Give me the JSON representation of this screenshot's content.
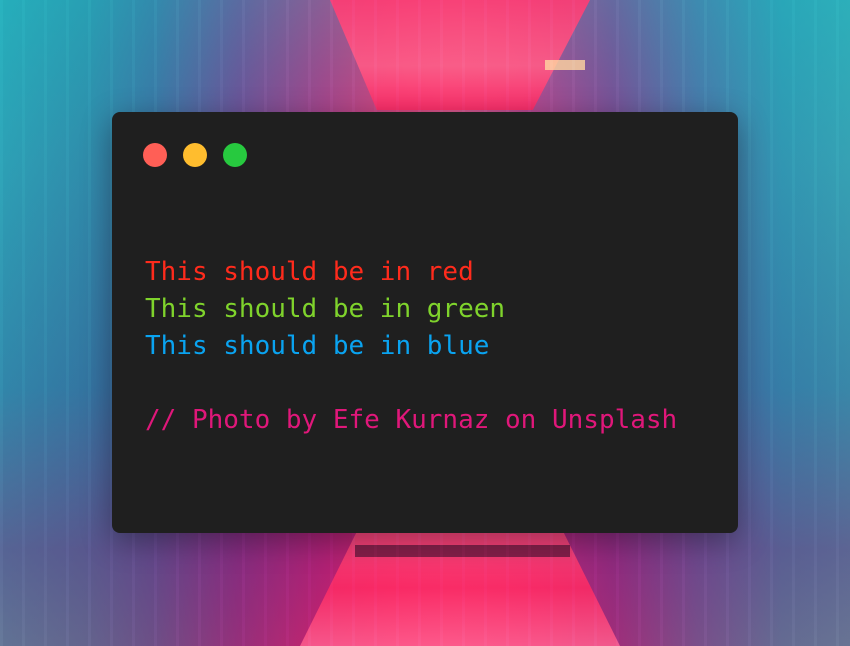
{
  "window": {
    "controls": [
      {
        "name": "close",
        "color": "#ff5f56"
      },
      {
        "name": "minimize",
        "color": "#ffbd2e"
      },
      {
        "name": "maximize",
        "color": "#27c93f"
      }
    ],
    "background_color": "#1f1f1f"
  },
  "code": {
    "lines": [
      {
        "text": "This should be in red",
        "color": "#ff2b1c"
      },
      {
        "text": "This should be in green",
        "color": "#7fd32c"
      },
      {
        "text": "This should be in blue",
        "color": "#0aa3f0"
      }
    ],
    "comment": {
      "text": "// Photo by Efe Kurnaz on Unsplash",
      "color": "#e0177a"
    }
  },
  "colors": {
    "red": "#ff2b1c",
    "green": "#7fd32c",
    "blue": "#0aa3f0",
    "comment": "#e0177a"
  }
}
